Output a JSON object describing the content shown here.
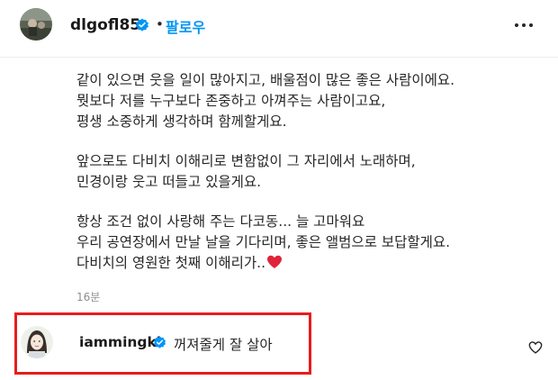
{
  "header": {
    "username": "dlgofl85",
    "separator": "•",
    "follow_label": "팔로우",
    "more_icon": "more-horizontal-icon"
  },
  "caption": {
    "paragraphs": [
      [
        "같이 있으면 웃을 일이 많아지고, 배울점이 많은 좋은 사람이에요.",
        "뭣보다 저를 누구보다 존중하고 아껴주는 사람이고요,",
        "평생 소중하게 생각하며 함께할게요."
      ],
      [
        "앞으로도 다비치 이해리로 변함없이 그 자리에서 노래하며,",
        "민경이랑 웃고 떠들고 있을게요."
      ],
      [
        "항상 조건 없이 사랑해 주는 다코동... 늘 고마워요",
        "우리 공연장에서 만날 날을 기다리며, 좋은 앨범으로 보답할게요.",
        "다비치의 영원한 첫째 이해리가.."
      ]
    ],
    "emoji": "red-heart-icon"
  },
  "post_time": "16분",
  "comment": {
    "username": "iammingki",
    "text": "꺼져줄게 잘 살아",
    "like_icon": "heart-outline-icon"
  },
  "colors": {
    "accent": "#0095f6",
    "verified": "#0095f6",
    "highlight_border": "#e81c1c",
    "heart": "#e0243a"
  }
}
